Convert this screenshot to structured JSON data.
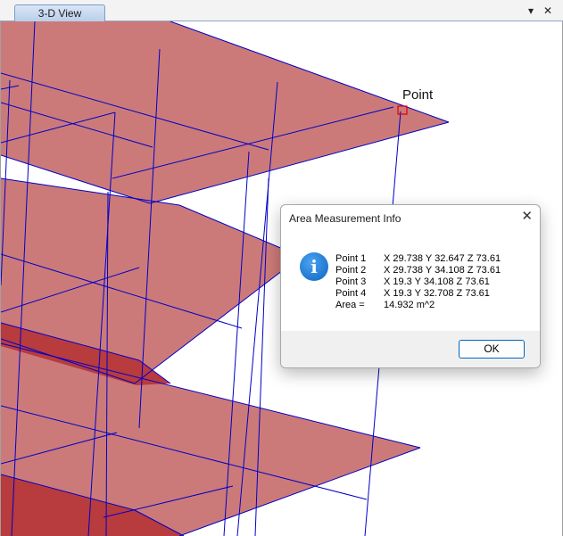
{
  "tab": {
    "label": "3-D View"
  },
  "window_controls": {
    "dropdown_icon": "chevron-down-icon",
    "close_icon": "close-icon"
  },
  "viewport": {
    "point_label": "Point"
  },
  "dialog": {
    "title": "Area Measurement Info",
    "icon": "info-icon",
    "rows": [
      {
        "label": "Point 1",
        "value": "X 29.738  Y 32.647  Z 73.61"
      },
      {
        "label": "Point 2",
        "value": "X 29.738  Y 34.108  Z 73.61"
      },
      {
        "label": "Point 3",
        "value": "X 19.3  Y 34.108  Z 73.61"
      },
      {
        "label": "Point 4",
        "value": "X 19.3  Y 32.708  Z 73.61"
      },
      {
        "label": "Area =",
        "value": "14.932 m^2"
      }
    ],
    "ok_label": "OK"
  },
  "colors": {
    "slab_fill": "#cc7a79",
    "beam_fill": "#b83b3e",
    "grid_line": "#0000c8",
    "marker": "#e00000"
  }
}
